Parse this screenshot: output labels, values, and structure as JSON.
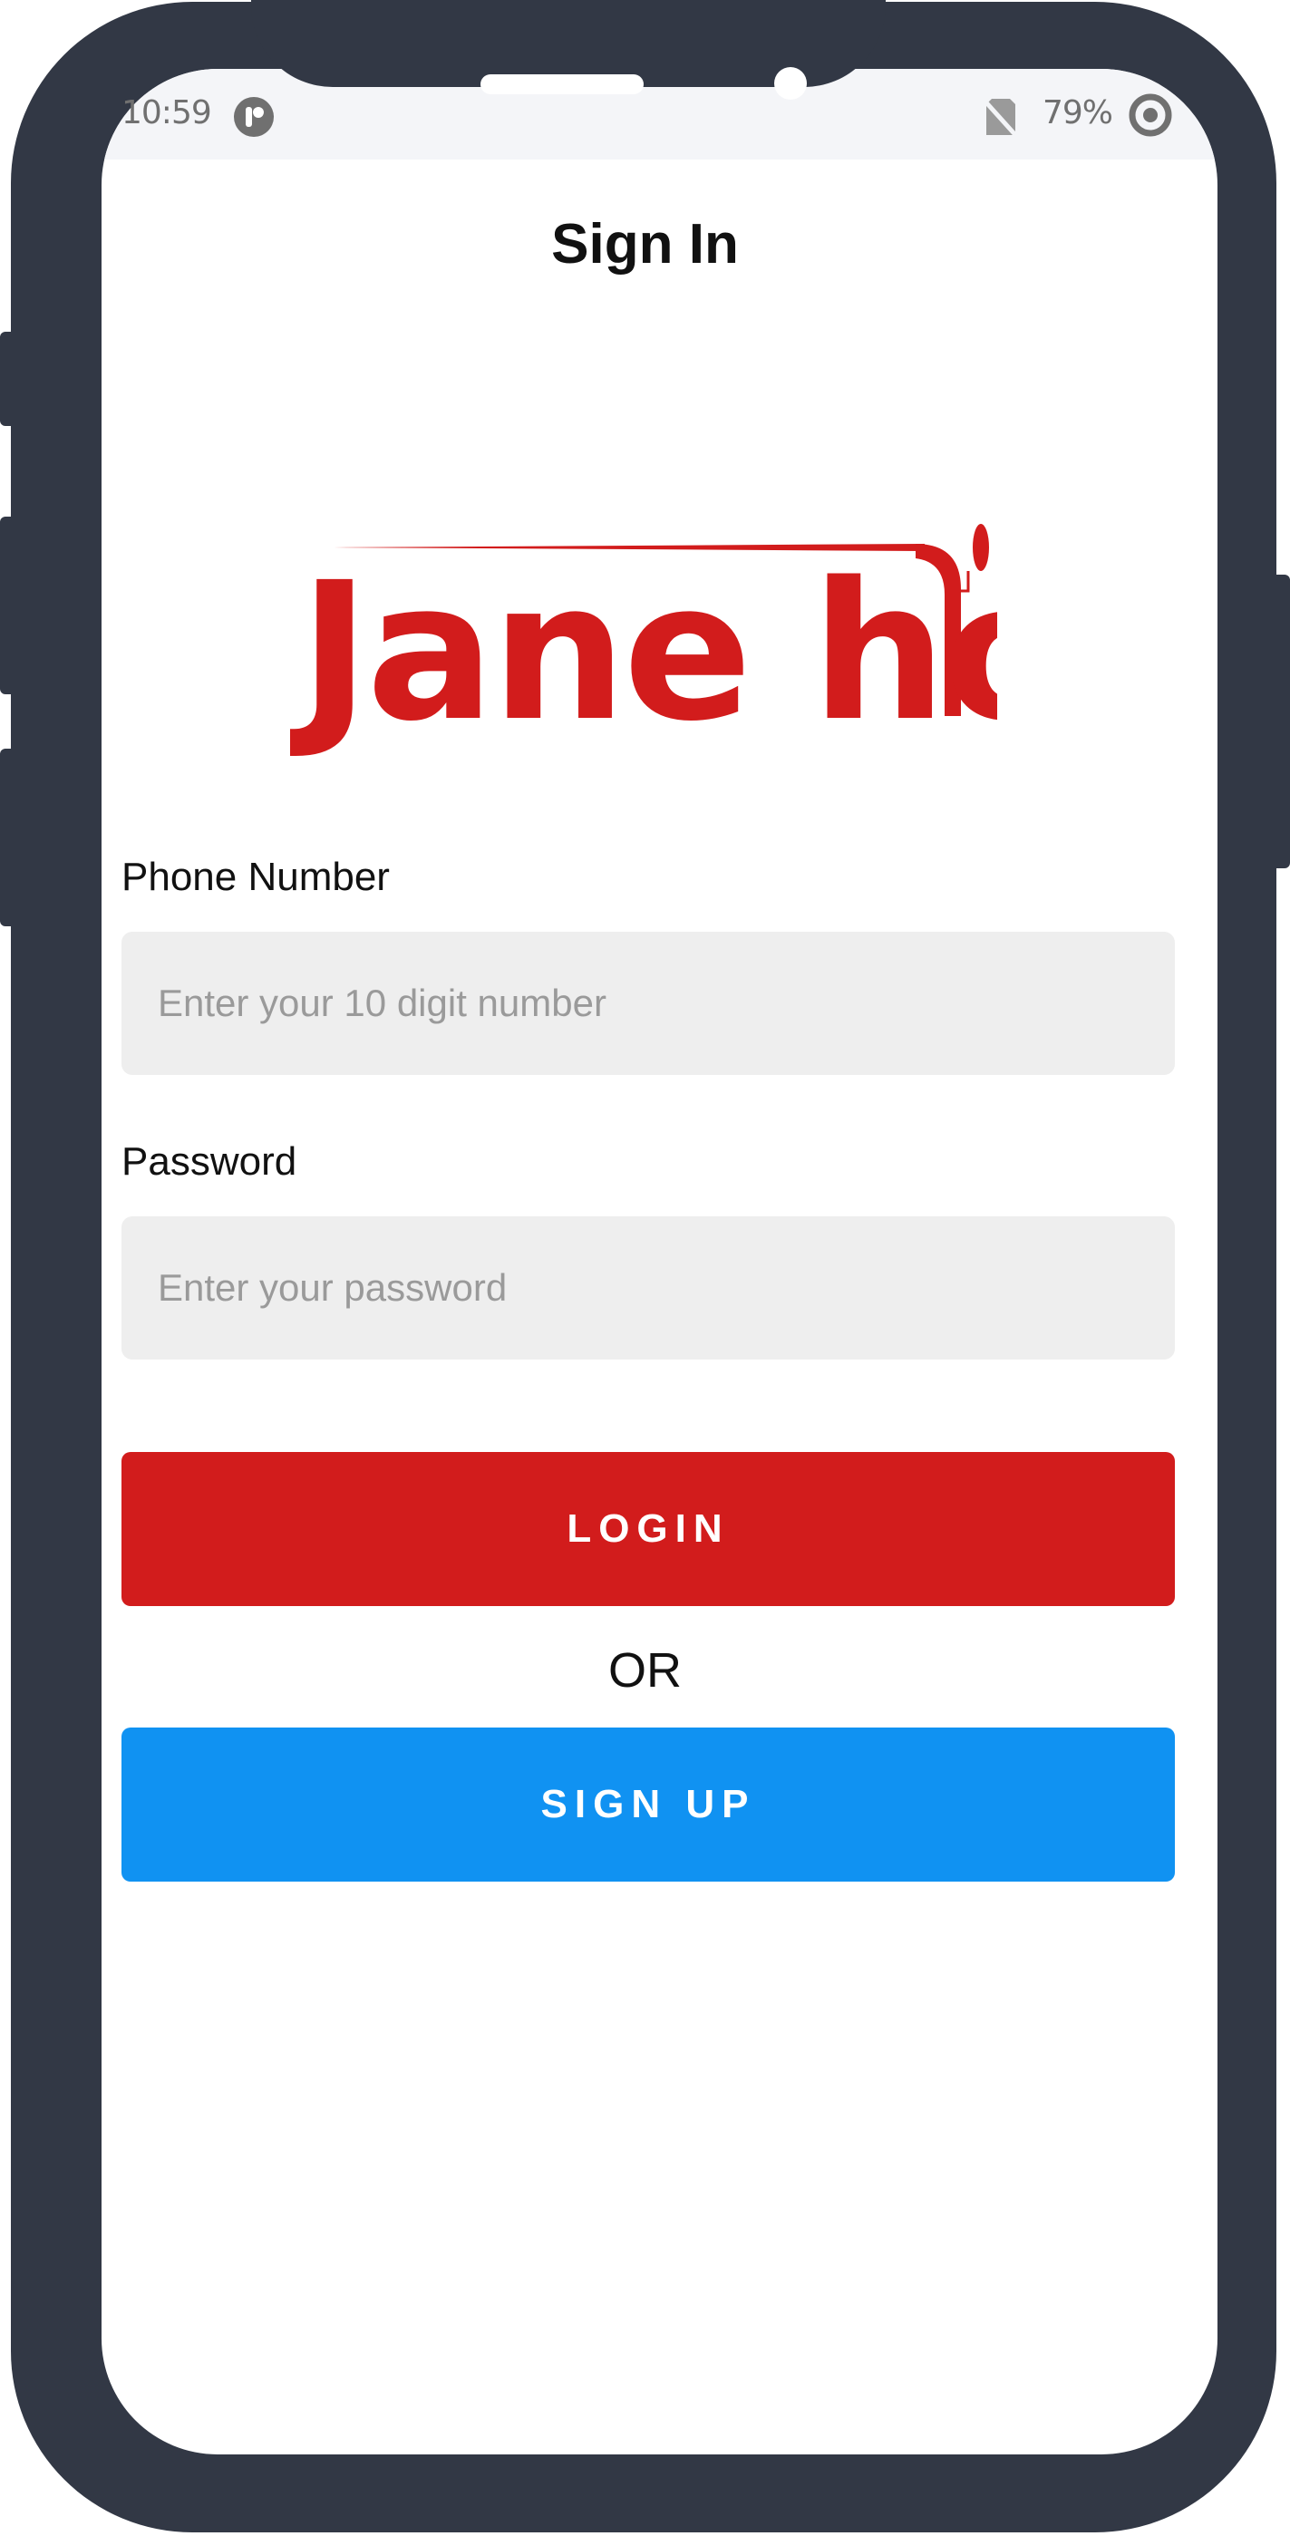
{
  "status_bar": {
    "time": "10:59",
    "battery_percent": "79%",
    "app_icon": "app-notification-icon",
    "sim_icon": "no-sim-icon",
    "battery_icon": "battery-ring-icon"
  },
  "header": {
    "title": "Sign In"
  },
  "logo": {
    "text": "Jane ho",
    "icon": "jane-ho-logo",
    "color": "#D21C1C"
  },
  "form": {
    "phone": {
      "label": "Phone Number",
      "placeholder": "Enter your 10 digit number",
      "value": ""
    },
    "password": {
      "label": "Password",
      "placeholder": "Enter your password",
      "value": ""
    }
  },
  "actions": {
    "login_label": "LOGIN",
    "or_label": "OR",
    "signup_label": "SIGN UP"
  },
  "colors": {
    "phone_frame": "#323845",
    "login_button": "#D21C1C",
    "signup_button": "#1092F2",
    "input_background": "#EEEEEE"
  }
}
